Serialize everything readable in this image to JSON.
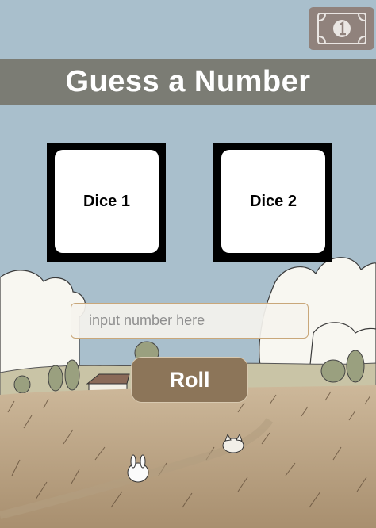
{
  "header": {
    "title": "Guess a Number"
  },
  "dice": [
    {
      "label": "Dice 1"
    },
    {
      "label": "Dice 2"
    }
  ],
  "input": {
    "placeholder": "input number here",
    "value": ""
  },
  "roll_button": {
    "label": "Roll"
  },
  "icons": {
    "top_right": "money-bill-icon"
  },
  "colors": {
    "sky": "#a9bfcc",
    "title_bar": "#7b7c74",
    "roll_button": "#8c7559",
    "money_button": "#8e7c74"
  }
}
